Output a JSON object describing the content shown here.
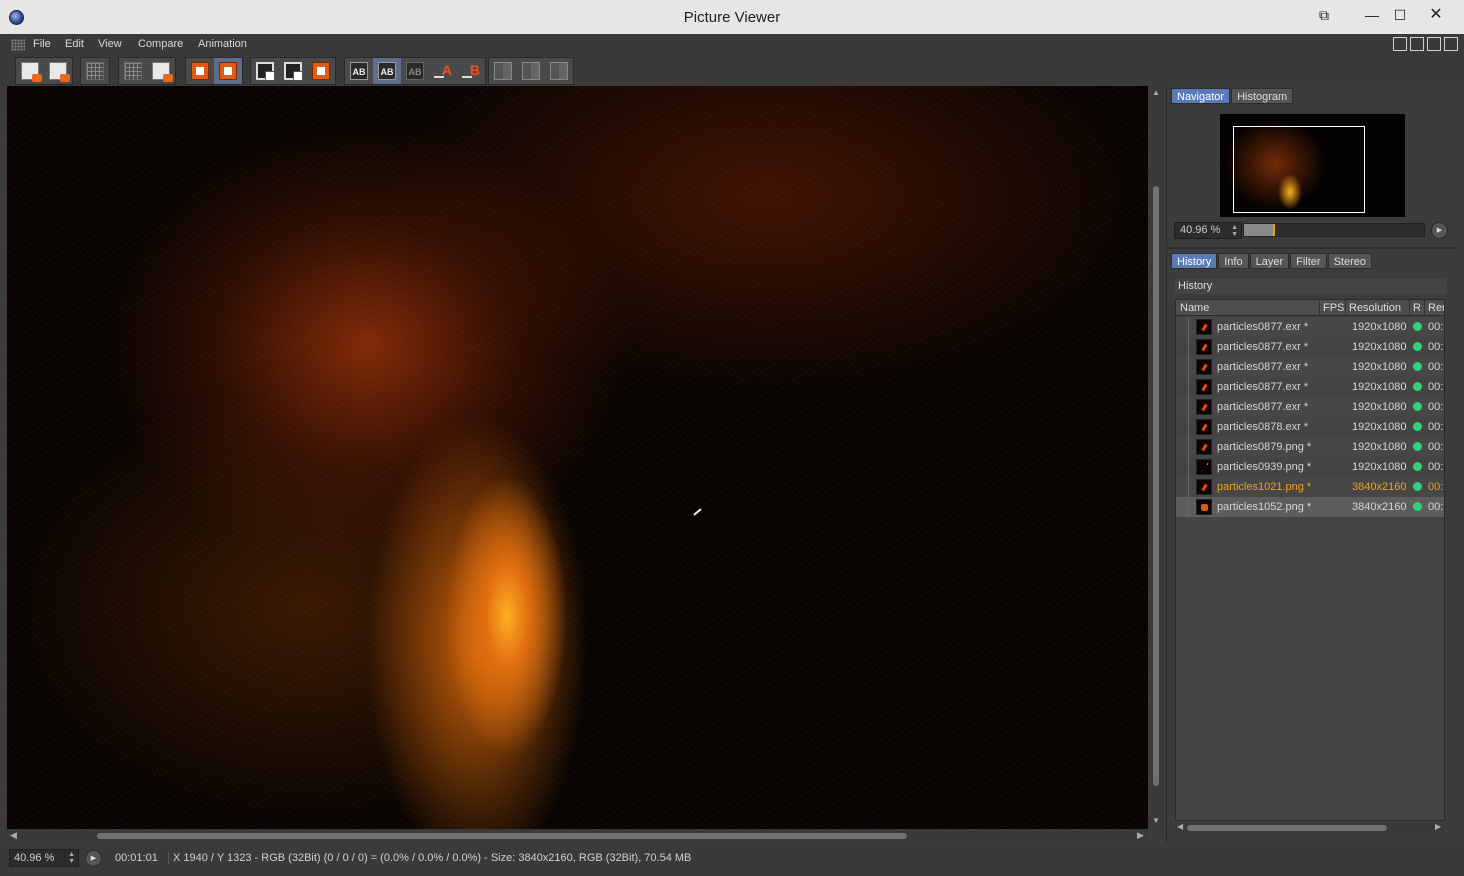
{
  "window": {
    "title": "Picture Viewer",
    "buttons": {
      "extra": "⧉",
      "minimize": "—",
      "maximize": "☐",
      "close": "✕"
    }
  },
  "menu": {
    "items": [
      "File",
      "Edit",
      "View",
      "Compare",
      "Animation"
    ]
  },
  "toolbar": {
    "buttons": [
      {
        "name": "open-icon"
      },
      {
        "name": "save-icon"
      },
      {
        "name": "render-region-icon"
      },
      {
        "name": "crop-icon"
      },
      {
        "name": "export-icon"
      },
      {
        "name": "copy-to-ab-icon"
      },
      {
        "name": "load-ab-icon"
      },
      {
        "name": "fit-frame-icon"
      },
      {
        "name": "fit-region-icon"
      },
      {
        "name": "view-stamp-icon"
      },
      {
        "name": "ab-compare-icon",
        "label": "AB"
      },
      {
        "name": "ab-overlay-icon",
        "label": "AB"
      },
      {
        "name": "ab-split-icon",
        "label": "AB"
      },
      {
        "name": "set-a-icon",
        "label": "A"
      },
      {
        "name": "set-b-icon",
        "label": "B"
      },
      {
        "name": "split-left-icon"
      },
      {
        "name": "split-center-icon"
      },
      {
        "name": "split-right-icon"
      }
    ]
  },
  "status": {
    "zoom": "40.96 %",
    "time": "00:01:01",
    "info": "X 1940 / Y 1323 - RGB (32Bit) (0 / 0 / 0) = (0.0% / 0.0% / 0.0%) - Size: 3840x2160, RGB (32Bit), 70.54 MB"
  },
  "navigator": {
    "tabs": [
      "Navigator",
      "Histogram"
    ],
    "active_tab": "Navigator",
    "zoom": "40.96 %",
    "slider_fraction": 0.16
  },
  "history": {
    "tabs": [
      "History",
      "Info",
      "Layer",
      "Filter",
      "Stereo"
    ],
    "active_tab": "History",
    "group_title": "History",
    "columns": [
      "Name",
      "FPS",
      "Resolution",
      "R",
      "Rer"
    ],
    "rows": [
      {
        "name": "particles0877.exr *",
        "res": "1920x1080",
        "ren": "00:"
      },
      {
        "name": "particles0877.exr *",
        "res": "1920x1080",
        "ren": "00:"
      },
      {
        "name": "particles0877.exr *",
        "res": "1920x1080",
        "ren": "00:"
      },
      {
        "name": "particles0877.exr *",
        "res": "1920x1080",
        "ren": "00:"
      },
      {
        "name": "particles0877.exr *",
        "res": "1920x1080",
        "ren": "00:"
      },
      {
        "name": "particles0878.exr *",
        "res": "1920x1080",
        "ren": "00:"
      },
      {
        "name": "particles0879.png *",
        "res": "1920x1080",
        "ren": "00:"
      },
      {
        "name": "particles0939.png *",
        "res": "1920x1080",
        "ren": "00:"
      },
      {
        "name": "particles1021.png *",
        "res": "3840x2160",
        "ren": "00:"
      },
      {
        "name": "particles1052.png *",
        "res": "3840x2160",
        "ren": "00:"
      }
    ],
    "highlight_row": 8,
    "selected_row": 9
  },
  "colors": {
    "accent_tab": "#5a7ab8",
    "highlight_text": "#f0a020",
    "status_dot": "#34d07a"
  }
}
